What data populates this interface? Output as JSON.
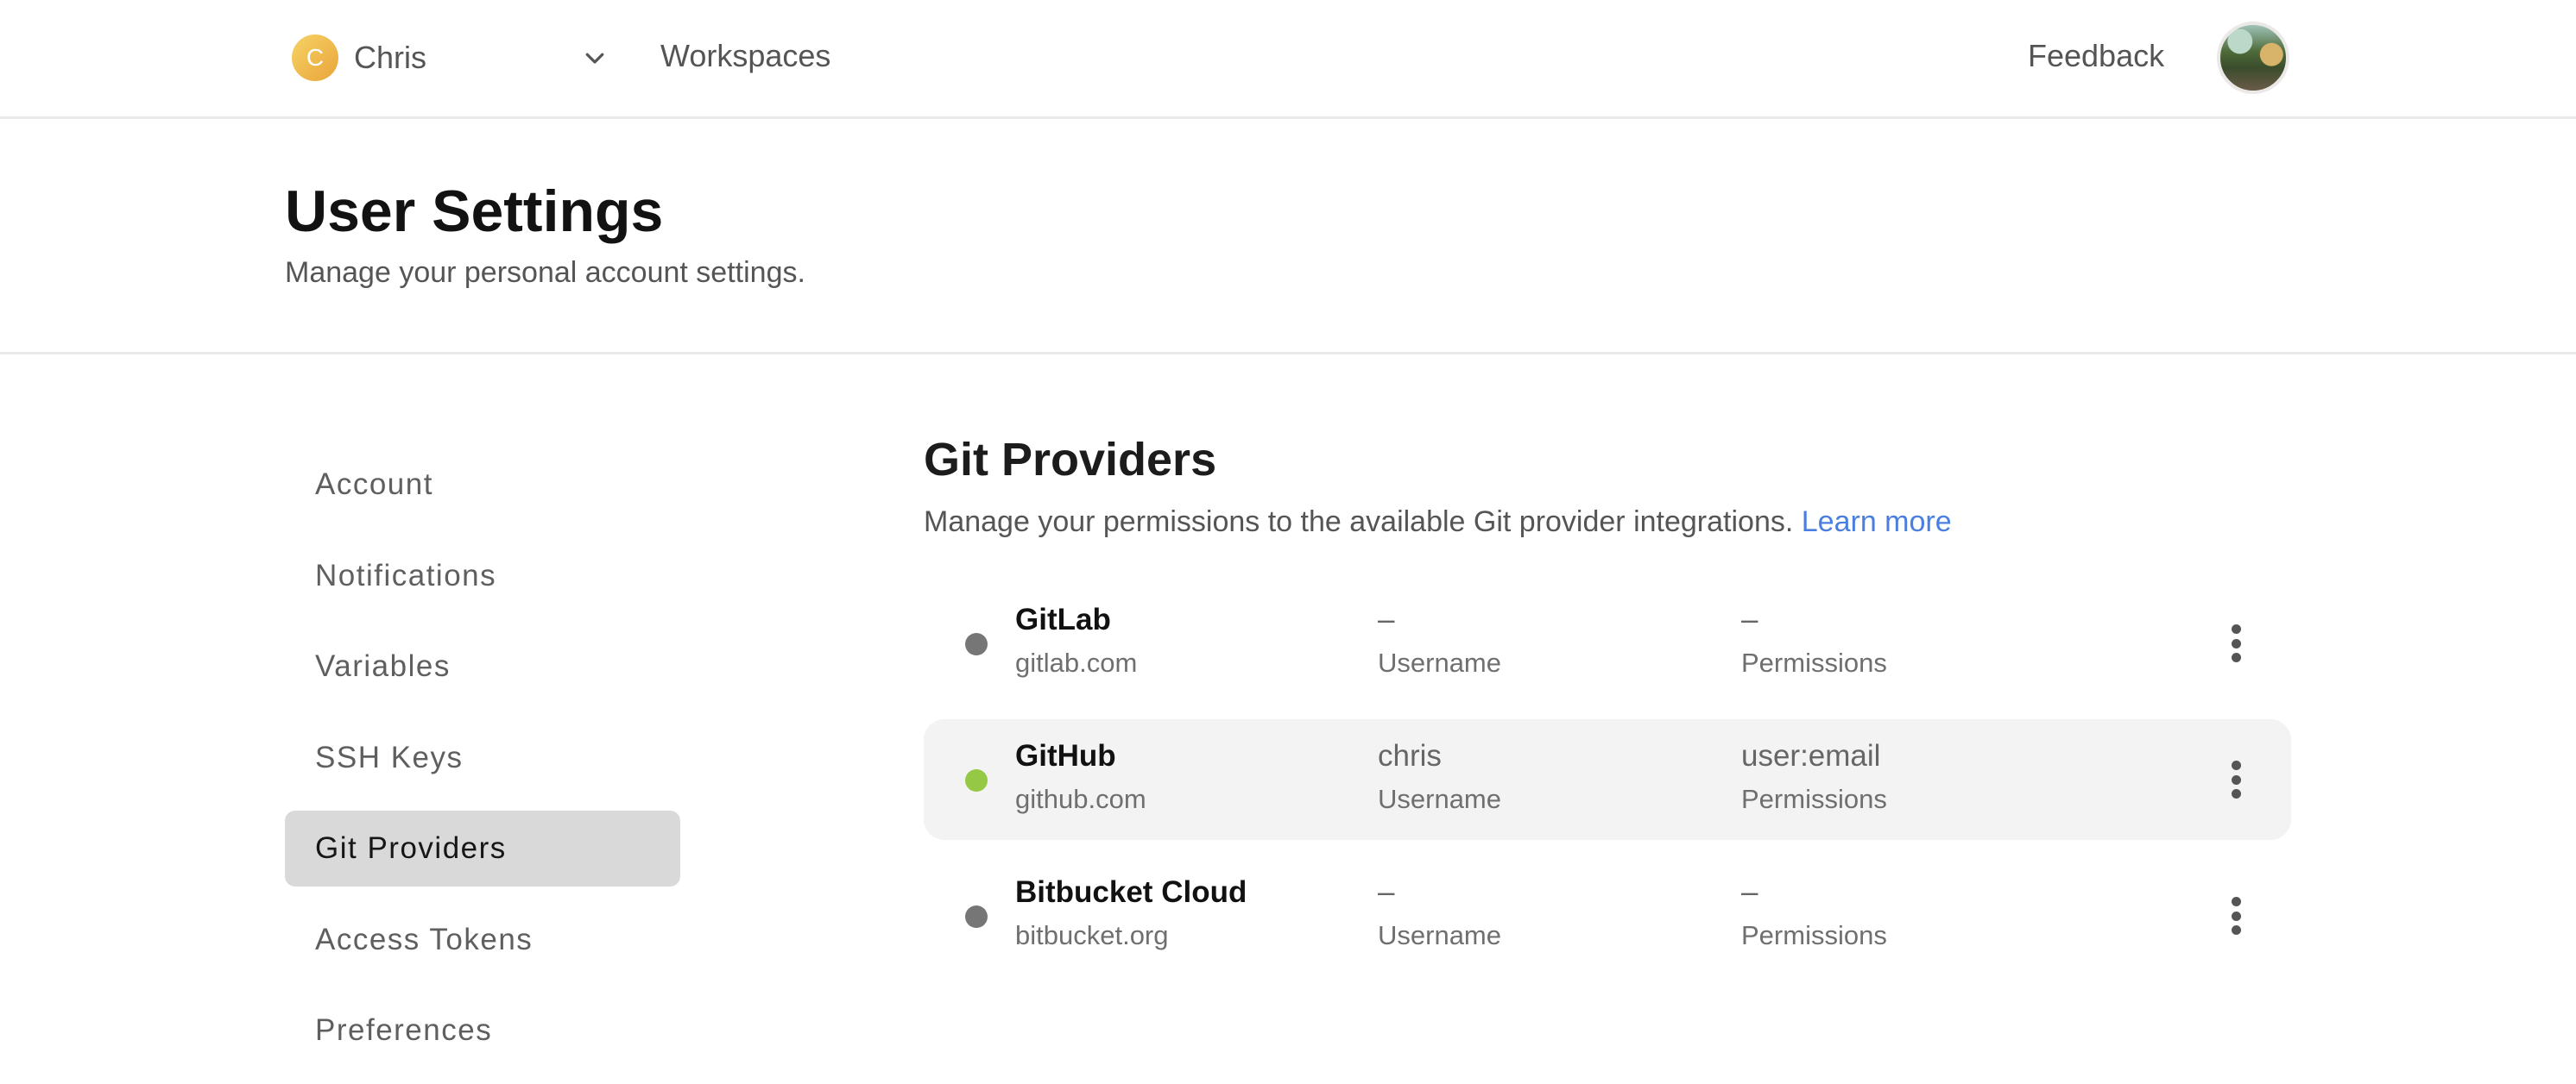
{
  "topbar": {
    "org_initial": "C",
    "org_name": "Chris",
    "workspaces_label": "Workspaces",
    "feedback_label": "Feedback"
  },
  "page": {
    "title": "User Settings",
    "subtitle": "Manage your personal account settings."
  },
  "sidebar": {
    "active": "Git Providers",
    "items": [
      {
        "label": "Account"
      },
      {
        "label": "Notifications"
      },
      {
        "label": "Variables"
      },
      {
        "label": "SSH Keys"
      },
      {
        "label": "Git Providers"
      },
      {
        "label": "Access Tokens"
      },
      {
        "label": "Preferences"
      }
    ]
  },
  "content": {
    "title": "Git Providers",
    "description": "Manage your permissions to the available Git provider integrations.",
    "learn_more_label": "Learn more"
  },
  "providers": [
    {
      "name": "GitLab",
      "host": "gitlab.com",
      "username": "–",
      "username_label": "Username",
      "permissions": "–",
      "permissions_label": "Permissions",
      "status": "disconnected",
      "status_color": "#767676"
    },
    {
      "name": "GitHub",
      "host": "github.com",
      "username": "chris",
      "username_label": "Username",
      "permissions": "user:email",
      "permissions_label": "Permissions",
      "status": "connected",
      "status_color": "#95c945"
    },
    {
      "name": "Bitbucket Cloud",
      "host": "bitbucket.org",
      "username": "–",
      "username_label": "Username",
      "permissions": "–",
      "permissions_label": "Permissions",
      "status": "disconnected",
      "status_color": "#767676"
    }
  ],
  "colors": {
    "link": "#4a7fe0",
    "active_nav_bg": "#d9d9d9",
    "highlight_row_bg": "#f3f3f3"
  }
}
